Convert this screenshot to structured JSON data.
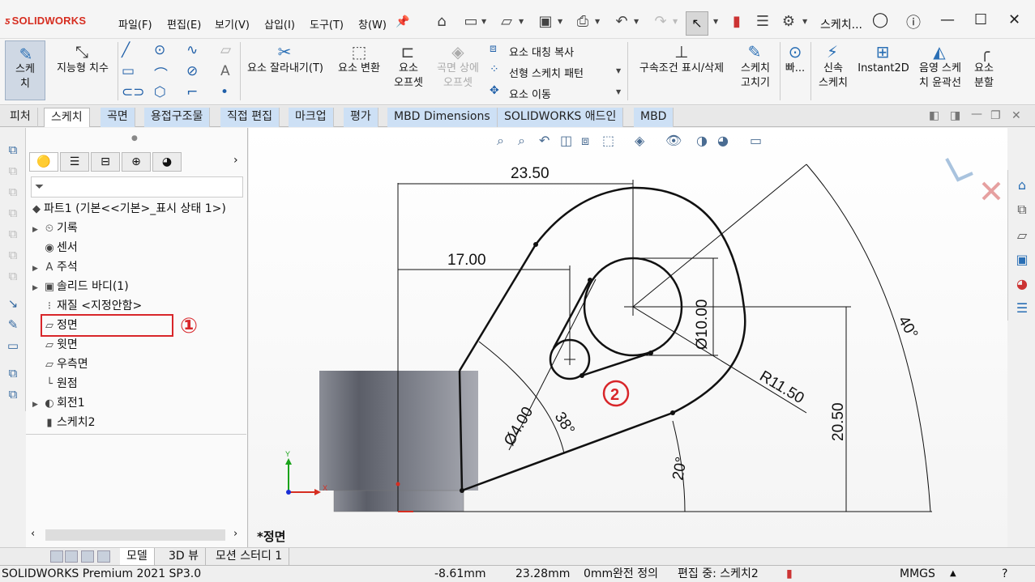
{
  "app": {
    "logo": "SOLIDWORKS",
    "menus": [
      "파일(F)",
      "편집(E)",
      "보기(V)",
      "삽입(I)",
      "도구(T)",
      "창(W)"
    ],
    "title": "스케치..."
  },
  "commands": {
    "sketch": "스케\n치",
    "smart_dim": "지능형 치수",
    "trim": "요소 잘라내기(T)",
    "convert": "요소 변환",
    "offset": "요소\n오프셋",
    "offset_surface": "곡면 상에\n오프셋",
    "mirror": "요소 대칭 복사",
    "linear_pattern": "선형 스케치 패턴",
    "move": "요소 이동",
    "relations": "구속조건 표시/삭제",
    "repair": "스케치\n고치기",
    "quick": "빠...",
    "rapid": "신속\n스케치",
    "instant2d": "Instant2D",
    "shaded": "음영 스케\n치 윤곽선",
    "split": "요소\n분할"
  },
  "tabs": [
    "피처",
    "스케치",
    "곡면",
    "용접구조물",
    "직접 편집",
    "마크업",
    "평가",
    "MBD Dimensions",
    "SOLIDWORKS 애드인",
    "MBD"
  ],
  "active_tab": "스케치",
  "tree": {
    "root": "파트1  (기본<<기본>_표시 상태 1>)",
    "items": [
      "기록",
      "센서",
      "주석",
      "솔리드 바디(1)",
      "재질 <지정안함>",
      "정면",
      "윗면",
      "우측면",
      "원점",
      "회전1",
      "스케치2"
    ]
  },
  "annotations": {
    "one": "①",
    "two": "②"
  },
  "bottom_tabs": [
    "모델",
    "3D 뷰",
    "모션 스터디 1"
  ],
  "view_name": "*정면",
  "status": {
    "product": "SOLIDWORKS Premium 2021 SP3.0",
    "x": "-8.61mm",
    "y": "23.28mm",
    "z": "0mm",
    "state": "완전 정의",
    "editing": "편집 중: 스케치2",
    "units": "MMGS"
  },
  "dims": {
    "d1": "23.50",
    "d2": "17.00",
    "d3": "Ø10.00",
    "d4": "R11.50",
    "d5": "20.50",
    "d6": "Ø4.00",
    "d7": "38°",
    "d8": "20°",
    "d9": "40°"
  },
  "axes": {
    "x": "X",
    "y": "Y"
  },
  "colors": {
    "accent": "#d8262a",
    "sketch": "#111111",
    "highlight": "#cde0f5"
  }
}
